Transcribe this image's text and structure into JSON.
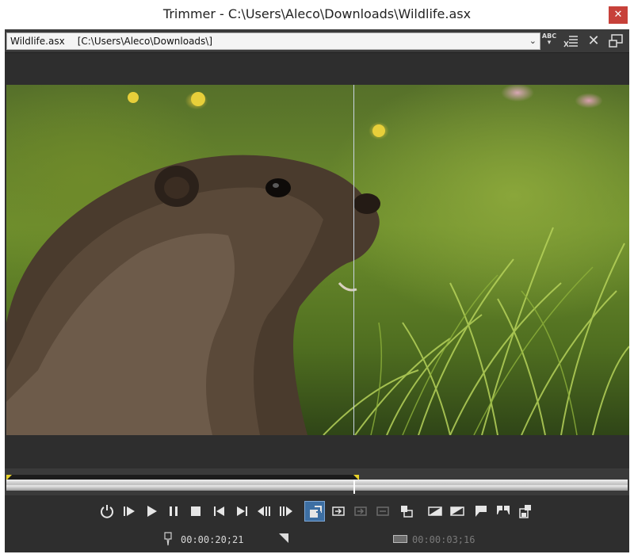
{
  "window": {
    "title": "Trimmer - C:\\Users\\Aleco\\Downloads\\Wildlife.asx",
    "close_glyph": "✕"
  },
  "path_bar": {
    "file_name": "Wildlife.asx",
    "folder": "[C:\\Users\\Aleco\\Downloads\\]",
    "spell_icon_text": "ABC",
    "tools": [
      "spellcheck-icon",
      "filter-list-icon",
      "close-icon",
      "dock-window-icon"
    ]
  },
  "timeline": {
    "selection_end_fraction": 0.566,
    "cursor_fraction": 0.561
  },
  "transport": {
    "buttons": [
      "loop-playback-icon",
      "play-from-start-icon",
      "play-icon",
      "pause-icon",
      "stop-icon",
      "previous-frame-icon",
      "next-frame-icon",
      "step-back-icon",
      "step-forward-icon",
      "overwrite-mode-icon",
      "insert-icon",
      "add-to-timeline-dim-icon",
      "fit-dim-icon",
      "trim-event-icon",
      "set-in-icon",
      "set-out-icon",
      "marker-icon",
      "region-icon",
      "save-icon"
    ],
    "active": "overwrite-mode-icon"
  },
  "status": {
    "cursor_time": "00:00:20;21",
    "selection_length": "00:00:03;16"
  }
}
